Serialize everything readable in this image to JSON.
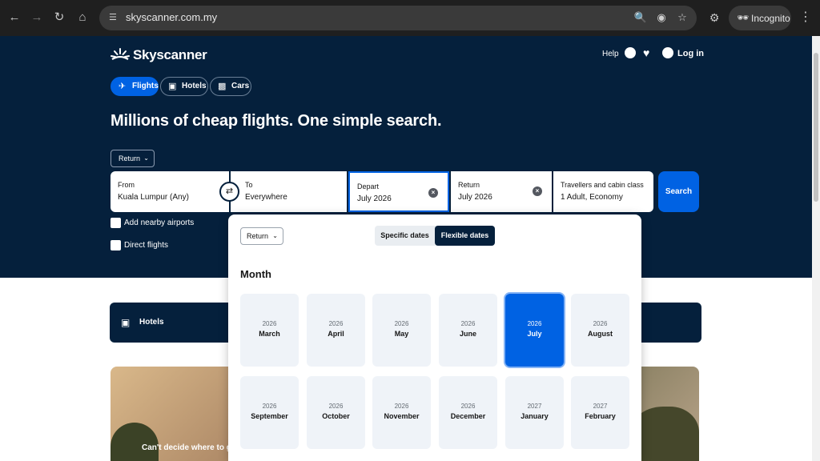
{
  "browser": {
    "url": "skyscanner.com.my",
    "incognito_label": "Incognito"
  },
  "header": {
    "logo_text": "Skyscanner",
    "help_label": "Help",
    "login_label": "Log in"
  },
  "verticals": [
    {
      "label": "Flights",
      "icon": "plane-icon",
      "active": true
    },
    {
      "label": "Hotels",
      "icon": "bed-icon",
      "active": false
    },
    {
      "label": "Cars",
      "icon": "car-icon",
      "active": false
    }
  ],
  "headline": "Millions of cheap flights. One simple search.",
  "search": {
    "trip_type": "Return",
    "from": {
      "label": "From",
      "value": "Kuala Lumpur (Any)"
    },
    "to": {
      "label": "To",
      "value": "Everywhere"
    },
    "depart": {
      "label": "Depart",
      "value": "July 2026"
    },
    "return": {
      "label": "Return",
      "value": "July 2026"
    },
    "travellers": {
      "label": "Travellers and cabin class",
      "value": "1 Adult, Economy"
    },
    "search_label": "Search",
    "nearby_label": "Add nearby airports",
    "direct_label": "Direct flights"
  },
  "below": {
    "hotels_label": "Hotels",
    "promo_text": "Can't decide where to go"
  },
  "date_picker": {
    "trip_type": "Return",
    "specific_label": "Specific dates",
    "flexible_label": "Flexible dates",
    "month_title": "Month",
    "months": [
      {
        "year": "2026",
        "month": "March"
      },
      {
        "year": "2026",
        "month": "April"
      },
      {
        "year": "2026",
        "month": "May"
      },
      {
        "year": "2026",
        "month": "June"
      },
      {
        "year": "2026",
        "month": "July"
      },
      {
        "year": "2026",
        "month": "August"
      },
      {
        "year": "2026",
        "month": "September"
      },
      {
        "year": "2026",
        "month": "October"
      },
      {
        "year": "2026",
        "month": "November"
      },
      {
        "year": "2026",
        "month": "December"
      },
      {
        "year": "2027",
        "month": "January"
      },
      {
        "year": "2027",
        "month": "February"
      }
    ],
    "selected_month": "July"
  },
  "colors": {
    "brand_dark": "#05203c",
    "accent_blue": "#0062e3"
  }
}
